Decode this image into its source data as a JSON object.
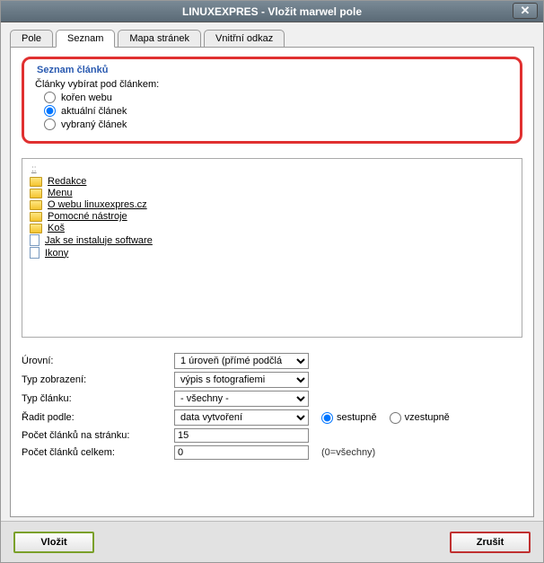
{
  "window": {
    "title": "LINUXEXPRES - Vložit marwel pole"
  },
  "tabs": [
    "Pole",
    "Seznam",
    "Mapa stránek",
    "Vnitřní odkaz"
  ],
  "active_tab": 1,
  "fieldset": {
    "legend": "Seznam článků",
    "label": "Články vybírat pod článkem:",
    "options": [
      "kořen webu",
      "aktuální článek",
      "vybraný článek"
    ],
    "selected": 1
  },
  "tree": {
    "header": "::",
    "items": [
      {
        "icon": "folder",
        "label": "Redakce"
      },
      {
        "icon": "folder",
        "label": "Menu"
      },
      {
        "icon": "folder",
        "label": "O webu linuxexpres.cz"
      },
      {
        "icon": "folder",
        "label": "Pomocné nástroje"
      },
      {
        "icon": "folder",
        "label": "Koš"
      },
      {
        "icon": "page",
        "label": "Jak se instaluje software"
      },
      {
        "icon": "page",
        "label": "Ikony"
      }
    ]
  },
  "form": {
    "levels_label": "Úrovní:",
    "levels_value": "1 úroveň (přímé podčlá",
    "display_label": "Typ zobrazení:",
    "display_value": "výpis s fotografiemi",
    "type_label": "Typ článku:",
    "type_value": "- všechny -",
    "sort_label": "Řadit podle:",
    "sort_value": "data vytvoření",
    "sort_desc": "sestupně",
    "sort_asc": "vzestupně",
    "perpage_label": "Počet článků na stránku:",
    "perpage_value": "15",
    "total_label": "Počet článků celkem:",
    "total_value": "0",
    "total_hint": "(0=všechny)"
  },
  "footer": {
    "insert": "Vložit",
    "cancel": "Zrušit"
  }
}
